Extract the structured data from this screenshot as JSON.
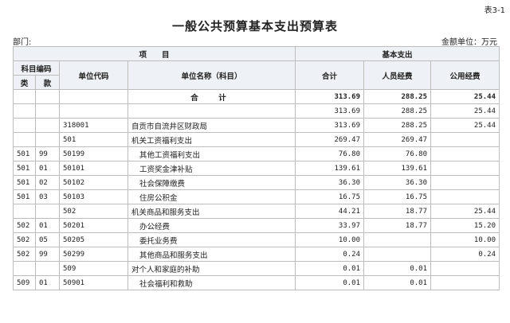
{
  "table_tag": "表3-1",
  "title": "一般公共预算基本支出预算表",
  "dept_label": "部门:",
  "unit_label": "金额单位：万元",
  "headers": {
    "project": "项　　目",
    "basic": "基本支出",
    "subject_code": "科目编码",
    "lei": "类",
    "kuan": "款",
    "unit_code": "单位代码",
    "unit_name": "单位名称（科目）",
    "total": "合计",
    "personnel": "人员经费",
    "public": "公用经费"
  },
  "total_row": {
    "label": "合　计",
    "total": "313.69",
    "personnel": "288.25",
    "public": "25.44"
  },
  "rows": [
    {
      "lei": "",
      "kuan": "",
      "code": "",
      "name": "",
      "total": "313.69",
      "personnel": "288.25",
      "public": "25.44",
      "indent": 1
    },
    {
      "lei": "",
      "kuan": "",
      "code": "318001",
      "name": "自贡市自流井区财政局",
      "total": "313.69",
      "personnel": "288.25",
      "public": "25.44",
      "indent": 1
    },
    {
      "lei": "",
      "kuan": "",
      "code": "501",
      "name": "机关工资福利支出",
      "total": "269.47",
      "personnel": "269.47",
      "public": "",
      "indent": 1
    },
    {
      "lei": "501",
      "kuan": "99",
      "code": "50199",
      "name": "其他工资福利支出",
      "total": "76.80",
      "personnel": "76.80",
      "public": "",
      "indent": 2
    },
    {
      "lei": "501",
      "kuan": "01",
      "code": "50101",
      "name": "工资奖金津补贴",
      "total": "139.61",
      "personnel": "139.61",
      "public": "",
      "indent": 2
    },
    {
      "lei": "501",
      "kuan": "02",
      "code": "50102",
      "name": "社会保障缴费",
      "total": "36.30",
      "personnel": "36.30",
      "public": "",
      "indent": 2
    },
    {
      "lei": "501",
      "kuan": "03",
      "code": "50103",
      "name": "住房公积金",
      "total": "16.75",
      "personnel": "16.75",
      "public": "",
      "indent": 2
    },
    {
      "lei": "",
      "kuan": "",
      "code": "502",
      "name": "机关商品和服务支出",
      "total": "44.21",
      "personnel": "18.77",
      "public": "25.44",
      "indent": 1
    },
    {
      "lei": "502",
      "kuan": "01",
      "code": "50201",
      "name": "办公经费",
      "total": "33.97",
      "personnel": "18.77",
      "public": "15.20",
      "indent": 2
    },
    {
      "lei": "502",
      "kuan": "05",
      "code": "50205",
      "name": "委托业务费",
      "total": "10.00",
      "personnel": "",
      "public": "10.00",
      "indent": 2
    },
    {
      "lei": "502",
      "kuan": "99",
      "code": "50299",
      "name": "其他商品和服务支出",
      "total": "0.24",
      "personnel": "",
      "public": "0.24",
      "indent": 2
    },
    {
      "lei": "",
      "kuan": "",
      "code": "509",
      "name": "对个人和家庭的补助",
      "total": "0.01",
      "personnel": "0.01",
      "public": "",
      "indent": 1
    },
    {
      "lei": "509",
      "kuan": "01",
      "code": "50901",
      "name": "社会福利和救助",
      "total": "0.01",
      "personnel": "0.01",
      "public": "",
      "indent": 2
    }
  ]
}
